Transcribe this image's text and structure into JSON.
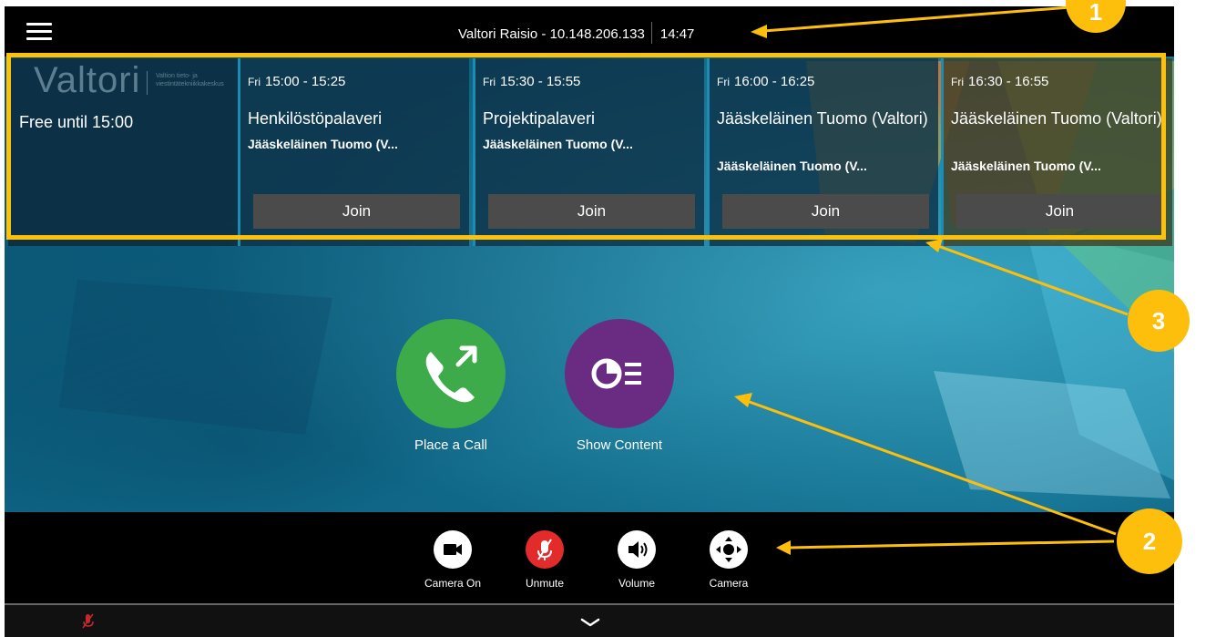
{
  "topbar": {
    "device": "Valtori Raisio - 10.148.206.133",
    "time": "14:47"
  },
  "calendar": {
    "logo_text": "Valtori",
    "logo_sub": "Valtion tieto- ja viestintätekniikkakeskus",
    "free_text": "Free until 15:00",
    "meetings": [
      {
        "day": "Fri",
        "time": "15:00 - 15:25",
        "title": "Henkilöstöpalaveri",
        "organizer": "Jääskeläinen Tuomo (V...",
        "join_label": "Join"
      },
      {
        "day": "Fri",
        "time": "15:30 - 15:55",
        "title": "Projektipalaveri",
        "organizer": "Jääskeläinen Tuomo (V...",
        "join_label": "Join"
      },
      {
        "day": "Fri",
        "time": "16:00 - 16:25",
        "title": "Jääskeläinen Tuomo (Valtori)",
        "organizer": "Jääskeläinen Tuomo (V...",
        "join_label": "Join"
      },
      {
        "day": "Fri",
        "time": "16:30 - 16:55",
        "title": "Jääskeläinen Tuomo (Valtori)",
        "organizer": "Jääskeläinen Tuomo (V...",
        "join_label": "Join"
      }
    ]
  },
  "actions": {
    "place_call": "Place a Call",
    "show_content": "Show Content"
  },
  "controls": {
    "camera_on": "Camera On",
    "unmute": "Unmute",
    "volume": "Volume",
    "camera": "Camera"
  },
  "callouts": [
    "1",
    "2",
    "3"
  ],
  "colors": {
    "callout": "#fdbf0b",
    "call_green": "#3dab4a",
    "content_purple": "#6a2c83",
    "mute_red": "#e42b2b",
    "join_gray": "#4b4b4b"
  },
  "icons": [
    "menu-icon",
    "phone-outgoing-icon",
    "share-content-icon",
    "video-camera-icon",
    "microphone-muted-icon",
    "speaker-icon",
    "camera-control-icon",
    "chevron-down-icon"
  ]
}
